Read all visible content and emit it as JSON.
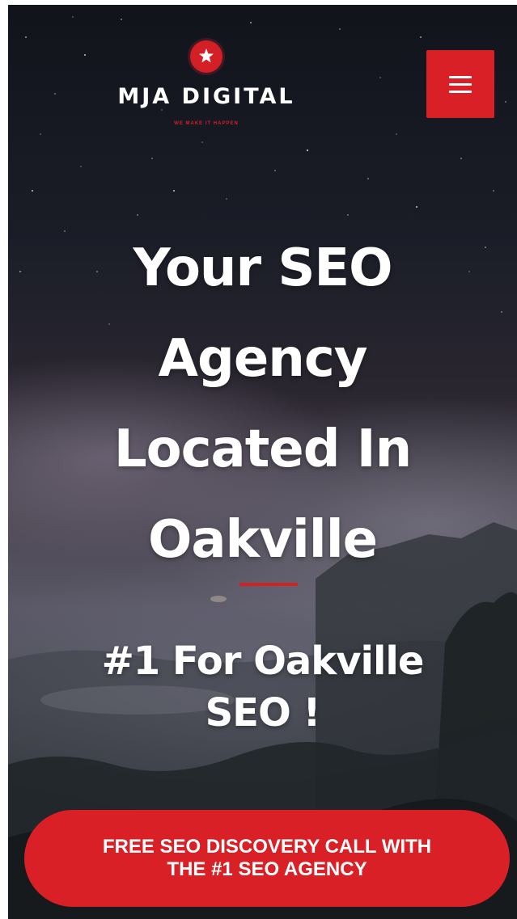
{
  "header": {
    "logo": {
      "name": "MJA DIGITAL",
      "tagline": "WE MAKE IT HAPPEN",
      "badge_icon": "star-icon"
    },
    "menu_button": {
      "icon": "hamburger-menu-icon"
    }
  },
  "hero": {
    "title": "Your SEO Agency Located In Oakville",
    "subtitle": "#1 For Oakville SEO !",
    "cta_label": "FREE SEO DISCOVERY CALL WITH THE #1 SEO AGENCY"
  },
  "colors": {
    "accent": "#d92026",
    "text": "#ffffff",
    "background_dark": "#12141c"
  }
}
